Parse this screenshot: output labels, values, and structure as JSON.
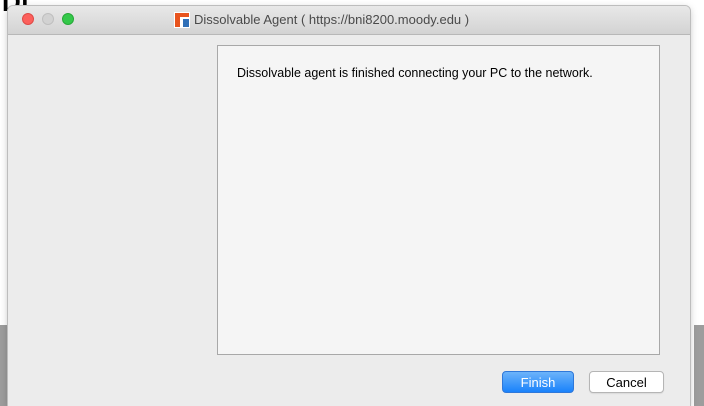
{
  "window": {
    "title": "Dissolvable Agent ( https://bni8200.moody.edu )",
    "app_icon": "dissolvable-agent-icon"
  },
  "content": {
    "message": "Dissolvable agent is finished connecting your PC to the network."
  },
  "buttons": {
    "finish_label": "Finish",
    "cancel_label": "Cancel"
  },
  "colors": {
    "close": "#fc605c",
    "minimize": "#d2d2d2",
    "maximize": "#34c84a",
    "primary_button": "#1a82fb"
  }
}
